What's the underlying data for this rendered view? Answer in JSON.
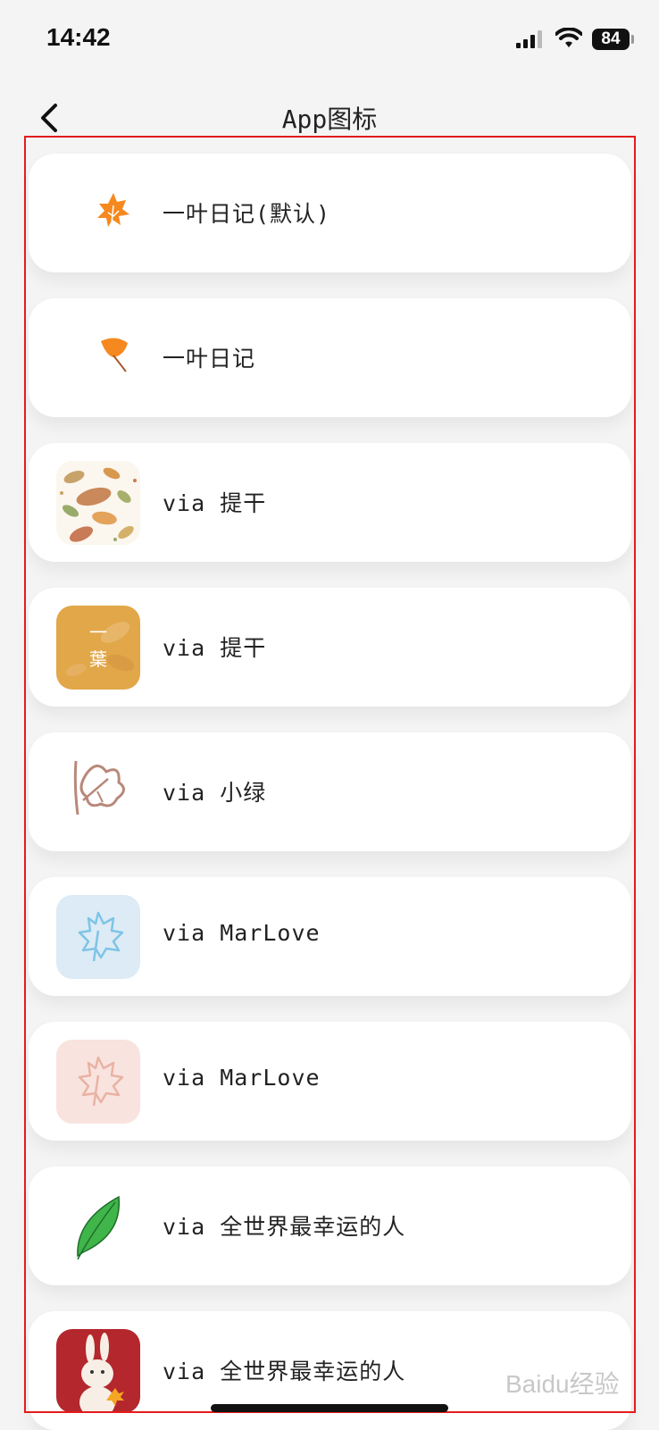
{
  "status_bar": {
    "time": "14:42",
    "battery": "84"
  },
  "nav": {
    "title": "App图标"
  },
  "icon_list": [
    {
      "label": "一叶日记(默认)",
      "icon": "maple-leaf-orange-icon"
    },
    {
      "label": "一叶日记",
      "icon": "ginkgo-leaf-orange-icon"
    },
    {
      "label": "via 提干",
      "icon": "autumn-leaves-pattern-icon"
    },
    {
      "label": "via 提干",
      "icon": "yellow-leaf-tile-icon",
      "tile_text_top": "一",
      "tile_text_bottom": "葉"
    },
    {
      "label": "via 小绿",
      "icon": "sketch-leaf-icon"
    },
    {
      "label": "via MarLove",
      "icon": "blue-maple-leaf-icon"
    },
    {
      "label": "via MarLove",
      "icon": "pink-maple-leaf-icon"
    },
    {
      "label": "via 全世界最幸运的人",
      "icon": "green-leaf-icon"
    },
    {
      "label": "via 全世界最幸运的人",
      "icon": "bunny-with-leaf-icon"
    }
  ],
  "watermark": "Baidu经验",
  "colors": {
    "background": "#f4f4f4",
    "card": "#ffffff",
    "highlight": "#e51b1b",
    "leaf_orange": "#f5891f",
    "leaf_green": "#3fb54a"
  }
}
